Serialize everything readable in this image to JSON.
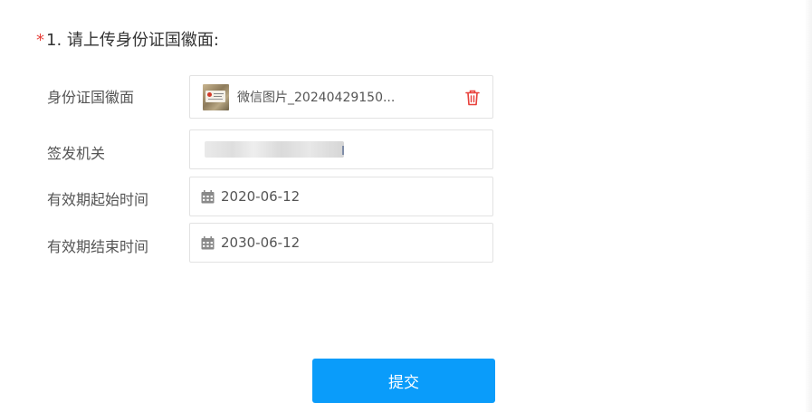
{
  "section": {
    "required_mark": "*",
    "title": "1. 请上传身份证国徽面:"
  },
  "fields": {
    "id_back": {
      "label": "身份证国徽面",
      "file_name": "微信图片_20240429150...",
      "thumbnail_icon": "image-thumbnail",
      "delete_icon": "trash-icon",
      "delete_color": "#e8403a"
    },
    "issuing_authority": {
      "label": "签发机关",
      "value_redacted": true
    },
    "valid_from": {
      "label": "有效期起始时间",
      "value": "2020-06-12",
      "icon": "calendar-icon"
    },
    "valid_to": {
      "label": "有效期结束时间",
      "value": "2030-06-12",
      "icon": "calendar-icon"
    }
  },
  "submit": {
    "label": "提交",
    "color": "#0a9cfa"
  }
}
